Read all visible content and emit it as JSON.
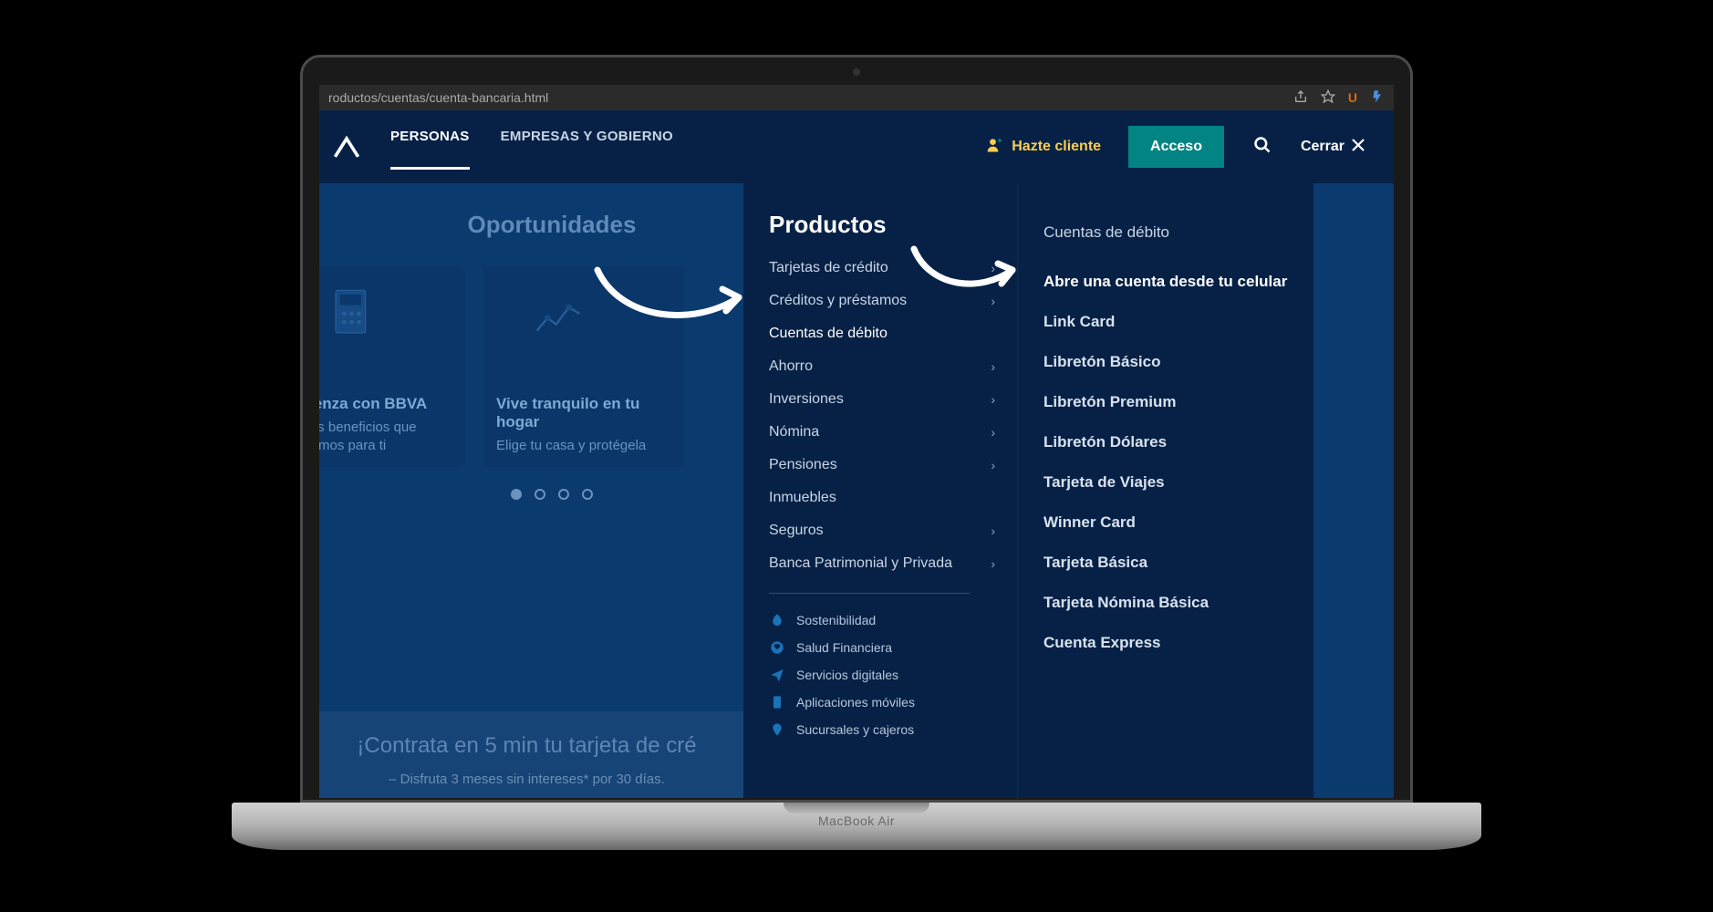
{
  "browser": {
    "url_fragment": "roductos/cuentas/cuenta-bancaria.html",
    "u_badge": "U"
  },
  "nav": {
    "tab1": "PERSONAS",
    "tab2": "EMPRESAS Y GOBIERNO",
    "cta": "Hazte cliente",
    "access": "Acceso",
    "close": "Cerrar"
  },
  "opportunities": {
    "title": "Oportunidades",
    "card1": {
      "title_frag": "mienza con BBVA",
      "line1_frag": "a los beneficios que",
      "line2_frag": "enemos para ti"
    },
    "card2": {
      "title": "Vive tranquilo en tu hogar",
      "line": "Elige tu casa y protégela"
    }
  },
  "promo": {
    "heading_frag": "¡Contrata en 5 min tu tarjeta de cré",
    "bullet1": "–   Disfruta 3 meses sin intereses* por 30 días."
  },
  "menu": {
    "title": "Productos",
    "items": [
      "Tarjetas de crédito",
      "Créditos y préstamos",
      "Cuentas de débito",
      "Ahorro",
      "Inversiones",
      "Nómina",
      "Pensiones",
      "Inmuebles",
      "Seguros",
      "Banca Patrimonial y Privada"
    ],
    "extras": [
      "Sostenibilidad",
      "Salud Financiera",
      "Servicios digitales",
      "Aplicaciones móviles",
      "Sucursales y cajeros"
    ]
  },
  "submenu": {
    "header": "Cuentas de débito",
    "items": [
      "Abre una cuenta desde tu celular",
      "Link Card",
      "Libretón Básico",
      "Libretón Premium",
      "Libretón Dólares",
      "Tarjeta de Viajes",
      "Winner Card",
      "Tarjeta Básica",
      "Tarjeta Nómina Básica",
      "Cuenta Express"
    ]
  },
  "device": {
    "label": "MacBook Air"
  }
}
